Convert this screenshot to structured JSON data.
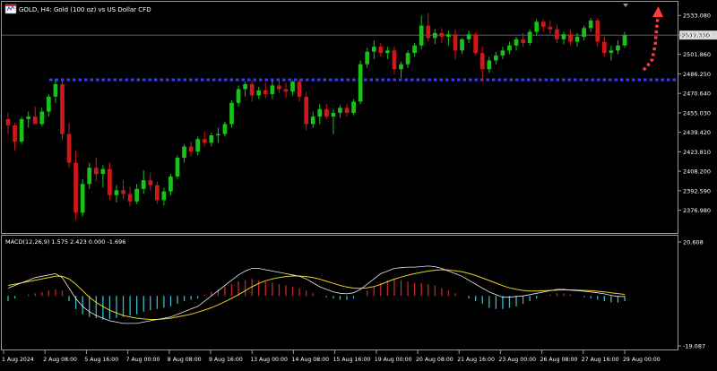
{
  "header": {
    "title": "GOLD, H4:  Gold (100 oz) vs US Dollar CFD"
  },
  "chart_data": [
    {
      "type": "candlestick",
      "title": "GOLD, H4:  Gold (100 oz) vs US Dollar CFD",
      "ylim": [
        2363.0,
        2539.0
      ],
      "y_ticks": [
        "2533.080",
        "2517.330",
        "2501.860",
        "2486.250",
        "2470.640",
        "2455.030",
        "2439.420",
        "2423.810",
        "2408.200",
        "2392.590",
        "2376.980"
      ],
      "current_price": "2517.330",
      "x_ticks": [
        "1 Aug 2024",
        "2 Aug 08:00",
        "5 Aug 16:00",
        "7 Aug 00:00",
        "8 Aug 08:00",
        "9 Aug 16:00",
        "13 Aug 00:00",
        "14 Aug 08:00",
        "15 Aug 16:00",
        "19 Aug 00:00",
        "20 Aug 08:00",
        "21 Aug 16:00",
        "23 Aug 00:00",
        "26 Aug 08:00",
        "27 Aug 16:00",
        "29 Aug 00:00"
      ],
      "support_level": 2481.5,
      "colors": {
        "bull": "#19c219",
        "bear": "#d01818",
        "support": "#3a3af0",
        "arrow": "#ff3b3b"
      },
      "candles": [
        [
          2450.0,
          2455.0,
          2438.0,
          2445.0
        ],
        [
          2445.0,
          2447.0,
          2425.0,
          2432.0
        ],
        [
          2432.0,
          2452.0,
          2430.0,
          2450.0
        ],
        [
          2450.0,
          2456.0,
          2443.0,
          2452.0
        ],
        [
          2452.0,
          2460.0,
          2447.0,
          2446.0
        ],
        [
          2446.0,
          2459.0,
          2444.0,
          2456.0
        ],
        [
          2456.0,
          2470.0,
          2452.0,
          2468.0
        ],
        [
          2468.0,
          2482.0,
          2463.0,
          2478.0
        ],
        [
          2478.0,
          2481.0,
          2433.0,
          2438.0
        ],
        [
          2438.0,
          2447.0,
          2411.0,
          2415.0
        ],
        [
          2415.0,
          2425.0,
          2369.0,
          2375.0
        ],
        [
          2375.0,
          2402.0,
          2372.0,
          2398.0
        ],
        [
          2398.0,
          2415.0,
          2394.0,
          2411.0
        ],
        [
          2411.0,
          2419.0,
          2400.0,
          2406.0
        ],
        [
          2406.0,
          2413.0,
          2395.0,
          2410.0
        ],
        [
          2410.0,
          2415.0,
          2385.0,
          2389.0
        ],
        [
          2389.0,
          2397.0,
          2383.0,
          2393.0
        ],
        [
          2393.0,
          2401.0,
          2386.0,
          2390.0
        ],
        [
          2390.0,
          2396.0,
          2380.0,
          2384.0
        ],
        [
          2384.0,
          2398.0,
          2382.0,
          2394.0
        ],
        [
          2394.0,
          2409.0,
          2390.0,
          2401.0
        ],
        [
          2401.0,
          2407.0,
          2393.0,
          2397.0
        ],
        [
          2397.0,
          2400.0,
          2382.0,
          2385.0
        ],
        [
          2385.0,
          2395.0,
          2381.0,
          2392.0
        ],
        [
          2392.0,
          2406.0,
          2389.0,
          2404.0
        ],
        [
          2404.0,
          2421.0,
          2402.0,
          2419.0
        ],
        [
          2419.0,
          2430.0,
          2415.0,
          2428.0
        ],
        [
          2428.0,
          2432.0,
          2420.0,
          2424.0
        ],
        [
          2424.0,
          2436.0,
          2421.0,
          2434.0
        ],
        [
          2434.0,
          2440.0,
          2428.0,
          2431.0
        ],
        [
          2431.0,
          2439.0,
          2428.0,
          2437.0
        ],
        [
          2437.0,
          2443.0,
          2431.0,
          2438.0
        ],
        [
          2438.0,
          2448.0,
          2436.0,
          2446.0
        ],
        [
          2446.0,
          2465.0,
          2443.0,
          2463.0
        ],
        [
          2463.0,
          2477.0,
          2460.0,
          2474.0
        ],
        [
          2474.0,
          2480.0,
          2468.0,
          2478.0
        ],
        [
          2478.0,
          2481.0,
          2464.0,
          2469.0
        ],
        [
          2469.0,
          2476.0,
          2466.0,
          2473.0
        ],
        [
          2473.0,
          2479.0,
          2467.0,
          2470.0
        ],
        [
          2470.0,
          2481.0,
          2466.0,
          2477.0
        ],
        [
          2477.0,
          2482.0,
          2471.0,
          2474.0
        ],
        [
          2474.0,
          2479.0,
          2467.0,
          2472.0
        ],
        [
          2472.0,
          2481.0,
          2469.0,
          2480.0
        ],
        [
          2480.0,
          2482.0,
          2464.0,
          2468.0
        ],
        [
          2468.0,
          2472.0,
          2441.0,
          2446.0
        ],
        [
          2446.0,
          2456.0,
          2443.0,
          2452.0
        ],
        [
          2452.0,
          2462.0,
          2446.0,
          2458.0
        ],
        [
          2458.0,
          2462.0,
          2450.0,
          2452.0
        ],
        [
          2452.0,
          2458.0,
          2438.0,
          2455.0
        ],
        [
          2455.0,
          2461.0,
          2451.0,
          2459.0
        ],
        [
          2459.0,
          2462.0,
          2452.0,
          2455.0
        ],
        [
          2455.0,
          2466.0,
          2453.0,
          2464.0
        ],
        [
          2464.0,
          2497.0,
          2462.0,
          2494.0
        ],
        [
          2494.0,
          2507.0,
          2491.0,
          2504.0
        ],
        [
          2504.0,
          2513.0,
          2498.0,
          2508.0
        ],
        [
          2508.0,
          2511.0,
          2500.0,
          2503.0
        ],
        [
          2503.0,
          2508.0,
          2498.0,
          2505.0
        ],
        [
          2505.0,
          2508.0,
          2486.0,
          2490.0
        ],
        [
          2490.0,
          2496.0,
          2483.0,
          2494.0
        ],
        [
          2494.0,
          2505.0,
          2491.0,
          2503.0
        ],
        [
          2503.0,
          2511.0,
          2500.0,
          2509.0
        ],
        [
          2509.0,
          2533.0,
          2506.0,
          2525.0
        ],
        [
          2525.0,
          2535.0,
          2512.0,
          2515.0
        ],
        [
          2515.0,
          2522.0,
          2510.0,
          2519.0
        ],
        [
          2519.0,
          2523.0,
          2511.0,
          2516.0
        ],
        [
          2516.0,
          2521.0,
          2509.0,
          2518.0
        ],
        [
          2518.0,
          2522.0,
          2498.0,
          2505.0
        ],
        [
          2505.0,
          2515.0,
          2502.0,
          2514.0
        ],
        [
          2514.0,
          2521.0,
          2511.0,
          2518.0
        ],
        [
          2518.0,
          2520.0,
          2501.0,
          2503.0
        ],
        [
          2503.0,
          2508.0,
          2480.0,
          2490.0
        ],
        [
          2490.0,
          2500.0,
          2487.0,
          2497.0
        ],
        [
          2497.0,
          2504.0,
          2494.0,
          2501.0
        ],
        [
          2501.0,
          2508.0,
          2498.0,
          2505.0
        ],
        [
          2505.0,
          2512.0,
          2502.0,
          2509.0
        ],
        [
          2509.0,
          2516.0,
          2505.0,
          2514.0
        ],
        [
          2514.0,
          2519.0,
          2508.0,
          2511.0
        ],
        [
          2511.0,
          2522.0,
          2509.0,
          2520.0
        ],
        [
          2520.0,
          2530.0,
          2517.0,
          2528.0
        ],
        [
          2528.0,
          2530.0,
          2520.0,
          2524.0
        ],
        [
          2524.0,
          2529.0,
          2518.0,
          2522.0
        ],
        [
          2522.0,
          2526.0,
          2511.0,
          2514.0
        ],
        [
          2514.0,
          2520.0,
          2510.0,
          2518.0
        ],
        [
          2518.0,
          2522.0,
          2509.0,
          2512.0
        ],
        [
          2512.0,
          2519.0,
          2508.0,
          2516.0
        ],
        [
          2516.0,
          2525.0,
          2513.0,
          2523.0
        ],
        [
          2523.0,
          2531.0,
          2520.0,
          2529.0
        ],
        [
          2529.0,
          2531.0,
          2508.0,
          2512.0
        ],
        [
          2512.0,
          2516.0,
          2500.0,
          2503.0
        ],
        [
          2503.0,
          2509.0,
          2497.0,
          2505.0
        ],
        [
          2505.0,
          2513.0,
          2502.0,
          2509.0
        ],
        [
          2509.0,
          2520.0,
          2507.0,
          2517.3
        ]
      ]
    },
    {
      "type": "line+bar",
      "title": "MACD(12,26,9) 1.575 2.423 0.000 -1.696",
      "ylim": [
        -19.087,
        20.608
      ],
      "y_ticks": [
        "20.608",
        "-19.087"
      ],
      "series": [
        {
          "kind": "bar",
          "values": [
            -2,
            -1,
            0,
            0.5,
            1,
            1.5,
            2,
            2.5,
            2,
            -2,
            -5,
            -7,
            -8,
            -8.5,
            -9,
            -9,
            -8.5,
            -8,
            -7.5,
            -7,
            -6,
            -5.5,
            -5,
            -4.5,
            -4,
            -3,
            -2,
            -1.5,
            -1,
            0.5,
            1.5,
            2.5,
            3.5,
            4.5,
            5.5,
            6,
            6.5,
            6,
            5.5,
            5,
            4.5,
            4,
            3.5,
            3,
            2,
            1,
            0,
            -0.5,
            -1,
            -1.5,
            -1.5,
            -1,
            0,
            2,
            3.5,
            5,
            6,
            6.5,
            6,
            5.5,
            5,
            5,
            4.5,
            4,
            3,
            2,
            1,
            0,
            -1,
            -2,
            -3,
            -4.5,
            -5,
            -5,
            -4.5,
            -4,
            -3,
            -2,
            -1,
            0,
            0.5,
            1,
            1,
            0.5,
            0,
            -0.5,
            -1,
            -1.5,
            -2,
            -2.5,
            -2.5,
            -2
          ]
        },
        {
          "kind": "line",
          "values": [
            3,
            4,
            5,
            6,
            7,
            7.5,
            8,
            8.5,
            7,
            3,
            -1,
            -4,
            -6,
            -7.5,
            -8.5,
            -9.5,
            -10,
            -10.5,
            -10.5,
            -10.5,
            -10,
            -9.5,
            -9,
            -8.5,
            -8,
            -7,
            -6,
            -5,
            -4,
            -2,
            0,
            2,
            4,
            6,
            8,
            9.5,
            10.5,
            10.5,
            10,
            9.5,
            9,
            8.5,
            8,
            7.5,
            6.5,
            5,
            3.5,
            2.5,
            1.5,
            1,
            0.8,
            1.2,
            2.5,
            4.5,
            6.5,
            8.5,
            9.5,
            10.5,
            10.8,
            11,
            11,
            11.2,
            11.4,
            11.2,
            10.5,
            9.5,
            8.5,
            7.5,
            6,
            4.5,
            3,
            1.5,
            0.5,
            -0.5,
            -0.5,
            -0.2,
            0,
            0.5,
            1,
            1.5,
            2,
            2.5,
            2.5,
            2.2,
            2,
            1.8,
            1.5,
            1.2,
            0.8,
            0.2,
            -0.2,
            -0.2
          ]
        },
        {
          "kind": "line",
          "values": [
            4,
            4.5,
            5,
            5.5,
            6,
            6.5,
            7,
            7.5,
            7.5,
            6.5,
            4.5,
            2,
            -0.5,
            -2.5,
            -4,
            -5.5,
            -6.5,
            -7.5,
            -8,
            -8.5,
            -8.8,
            -9,
            -9,
            -8.8,
            -8.5,
            -8,
            -7.5,
            -7,
            -6.2,
            -5.4,
            -4.5,
            -3.4,
            -2.2,
            -0.9,
            0.5,
            2,
            3.5,
            4.8,
            5.8,
            6.5,
            7,
            7.4,
            7.6,
            7.6,
            7.4,
            7,
            6.4,
            5.6,
            4.8,
            4,
            3.4,
            3,
            2.9,
            3.1,
            3.6,
            4.4,
            5.4,
            6.4,
            7.2,
            7.9,
            8.5,
            9,
            9.5,
            9.8,
            10,
            9.9,
            9.6,
            9.2,
            8.6,
            7.8,
            6.9,
            5.9,
            4.9,
            3.9,
            3.1,
            2.5,
            2.1,
            1.9,
            1.9,
            2,
            2.1,
            2.2,
            2.3,
            2.3,
            2.2,
            2.1,
            2,
            1.8,
            1.5,
            1.2,
            0.9,
            0.6
          ]
        }
      ]
    }
  ]
}
